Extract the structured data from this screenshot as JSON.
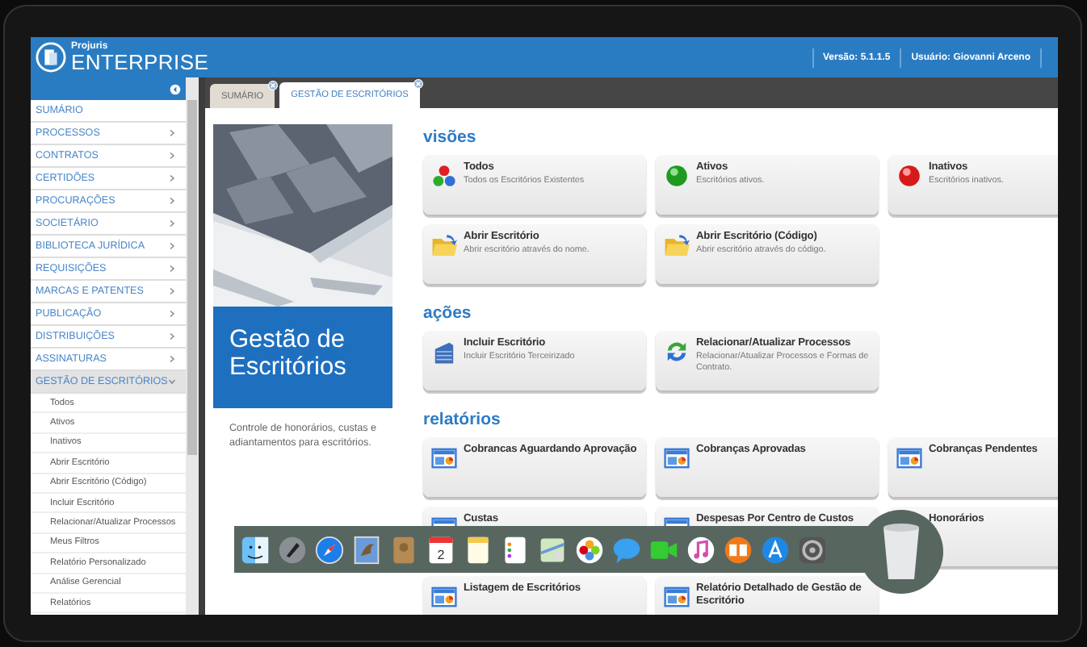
{
  "header": {
    "brand_small": "Projuris",
    "brand_large": "ENTERPRISE",
    "version": "Versão: 5.1.1.5",
    "user": "Usuário: Giovanni Arceno"
  },
  "sidebar": {
    "items": [
      {
        "label": "SUMÁRIO",
        "kind": "link"
      },
      {
        "label": "PROCESSOS",
        "kind": "menu",
        "expanded": false
      },
      {
        "label": "CONTRATOS",
        "kind": "menu",
        "expanded": false
      },
      {
        "label": "CERTIDÕES",
        "kind": "menu",
        "expanded": false
      },
      {
        "label": "PROCURAÇÕES",
        "kind": "menu",
        "expanded": false
      },
      {
        "label": "SOCIETÁRIO",
        "kind": "menu",
        "expanded": false
      },
      {
        "label": "BIBLIOTECA JURÍDICA",
        "kind": "menu",
        "expanded": false
      },
      {
        "label": "REQUISIÇÕES",
        "kind": "menu",
        "expanded": false
      },
      {
        "label": "MARCAS E PATENTES",
        "kind": "menu",
        "expanded": false
      },
      {
        "label": "PUBLICAÇÃO",
        "kind": "menu",
        "expanded": false
      },
      {
        "label": "DISTRIBUIÇÕES",
        "kind": "menu",
        "expanded": false
      },
      {
        "label": "ASSINATURAS",
        "kind": "menu",
        "expanded": false
      },
      {
        "label": "GESTÃO DE ESCRITÓRIOS",
        "kind": "menu",
        "expanded": true,
        "children": [
          {
            "label": "Todos"
          },
          {
            "label": "Ativos"
          },
          {
            "label": "Inativos"
          },
          {
            "label": "Abrir Escritório"
          },
          {
            "label": "Abrir Escritório (Código)"
          },
          {
            "label": "Incluir Escritório"
          },
          {
            "label": "Relacionar/Atualizar Processos"
          },
          {
            "label": "Meus Filtros"
          },
          {
            "label": "Relatório Personalizado"
          },
          {
            "label": "Análise Gerencial"
          },
          {
            "label": "Relatórios"
          }
        ]
      }
    ]
  },
  "tabs": [
    {
      "label": "SUMÁRIO",
      "selected": false
    },
    {
      "label": "GESTÃO DE ESCRITÓRIOS",
      "selected": true
    }
  ],
  "panel": {
    "title": "Gestão de Escritórios",
    "description": "Controle de honorários, custas e adiantamentos para escritórios."
  },
  "sections": [
    {
      "heading": "visões",
      "cards": [
        {
          "kind": "dots",
          "title": "Todos",
          "description": "Todos os Escritórios Existentes"
        },
        {
          "kind": "green",
          "title": "Ativos",
          "description": "Escritórios ativos."
        },
        {
          "kind": "red",
          "title": "Inativos",
          "description": "Escritórios inativos."
        },
        {
          "kind": "folder",
          "title": "Abrir Escritório",
          "description": "Abrir escritório através do nome."
        },
        {
          "kind": "folder",
          "title": "Abrir Escritório (Código)",
          "description": "Abrir escritório através do código."
        }
      ]
    },
    {
      "heading": "ações",
      "cards": [
        {
          "kind": "building",
          "title": "Incluir Escritório",
          "description": "Incluir Escritório Terceirizado"
        },
        {
          "kind": "refresh",
          "title": "Relacionar/Atualizar Processos",
          "description": "Relacionar/Atualizar Processos e Formas de Contrato."
        }
      ]
    },
    {
      "heading": "relatórios",
      "cards": [
        {
          "kind": "report",
          "title": "Cobrancas Aguardando Aprovação"
        },
        {
          "kind": "report",
          "title": "Cobranças Aprovadas"
        },
        {
          "kind": "report",
          "title": "Cobranças Pendentes"
        },
        {
          "kind": "report",
          "title": "Custas"
        },
        {
          "kind": "report",
          "title": "Despesas Por Centro de Custos"
        },
        {
          "title": "Honorários"
        },
        {
          "kind": "report",
          "title": "Listagem de Escritórios"
        },
        {
          "kind": "report",
          "title": "Relatório Detalhado de Gestão de Escritório"
        }
      ]
    }
  ],
  "dock": {
    "calendar_day": "2"
  }
}
